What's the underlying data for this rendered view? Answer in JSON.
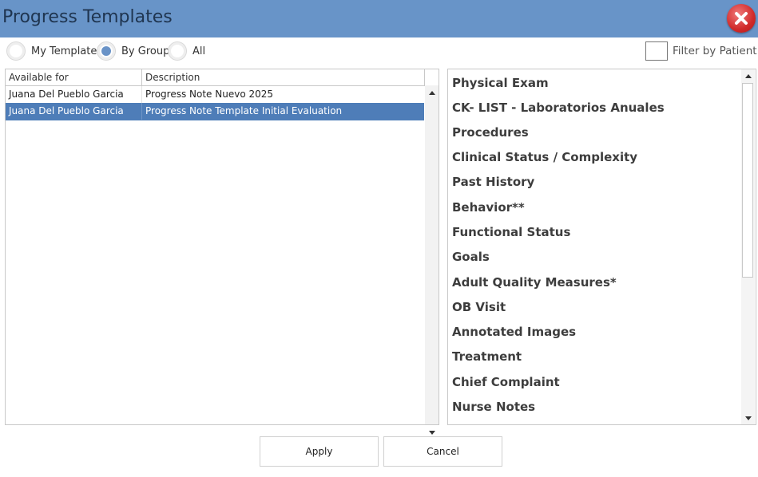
{
  "window": {
    "title": "Progress Templates"
  },
  "filters": {
    "radios": [
      {
        "label": "My Templates",
        "checked": false
      },
      {
        "label": "By Group",
        "checked": true
      },
      {
        "label": "All",
        "checked": false
      }
    ],
    "filter_by_patient": {
      "label": "Filter by Patient",
      "checked": false
    }
  },
  "template_grid": {
    "columns": [
      "Available for",
      "Description"
    ],
    "rows": [
      {
        "available_for": "Juana Del Pueblo Garcia",
        "description": "Progress Note Nuevo 2025",
        "selected": false
      },
      {
        "available_for": "Juana Del Pueblo Garcia",
        "description": "Progress Note Template Initial Evaluation",
        "selected": true
      }
    ]
  },
  "sections": [
    "Physical Exam",
    "CK- LIST - Laboratorios Anuales",
    "Procedures",
    "Clinical Status / Complexity",
    "Past History",
    "Behavior**",
    "Functional Status",
    "Goals",
    "Adult Quality Measures*",
    "OB Visit",
    "Annotated Images",
    "Treatment",
    "Chief Complaint",
    "Nurse Notes"
  ],
  "buttons": {
    "apply": "Apply",
    "cancel": "Cancel"
  },
  "icons": {
    "close": "close-x-icon",
    "scroll_up": "arrow-up-icon",
    "scroll_down": "arrow-down-icon"
  },
  "colors": {
    "titlebar": "#6894c8",
    "selection": "#4e7db8",
    "radio_checked": "#6a93c7",
    "close_button": "#d02a2a"
  }
}
